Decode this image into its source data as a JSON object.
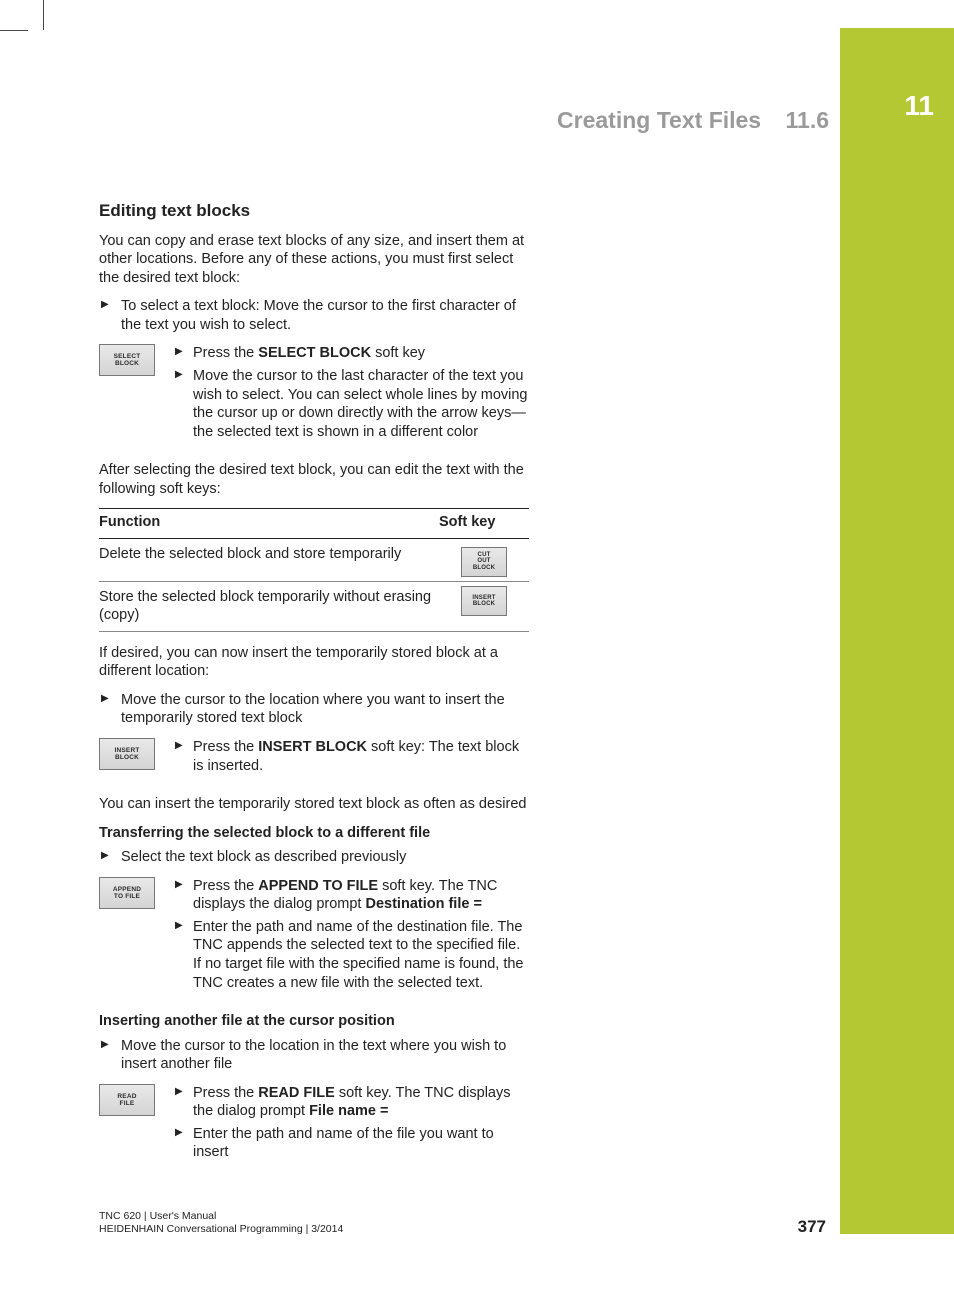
{
  "chapter": "11",
  "header": {
    "title": "Creating Text Files",
    "section": "11.6"
  },
  "h2": "Editing text blocks",
  "intro": "You can copy and erase text blocks of any size, and insert them at other locations. Before any of these actions, you must first select the desired text block:",
  "select_step": "To select a text block: Move the cursor to the first character of the text you wish to select.",
  "key_select": "SELECT\nBLOCK",
  "select_sub": {
    "a_pre": "Press the ",
    "a_bold": "SELECT BLOCK",
    "a_post": " soft key",
    "b": "Move the cursor to the last character of the text you wish to select. You can select whole lines by moving the cursor up or down directly with the arrow keys—the selected text is shown in a different color"
  },
  "after_select": "After selecting the desired text block, you can edit the text with the following soft keys:",
  "table": {
    "head_func": "Function",
    "head_key": "Soft key",
    "rows": [
      {
        "func": "Delete the selected block and store temporarily",
        "key": "CUT\nOUT\nBLOCK"
      },
      {
        "func": "Store the selected block temporarily without erasing (copy)",
        "key": "INSERT\nBLOCK"
      }
    ]
  },
  "insert_intro": "If desired, you can now insert the temporarily stored block at a different location:",
  "insert_step": "Move the cursor to the location where you want to insert the temporarily stored text block",
  "key_insert": "INSERT\nBLOCK",
  "insert_sub_pre": "Press the ",
  "insert_sub_bold": "INSERT BLOCK",
  "insert_sub_post": " soft key: The text block is inserted.",
  "insert_often": "You can insert the temporarily stored text block as often as desired",
  "transfer_head": "Transferring the selected block to a different file",
  "transfer_step": "Select the text block as described previously",
  "key_append": "APPEND\nTO FILE",
  "transfer_sub": {
    "a_pre": "Press the ",
    "a_bold": "APPEND TO FILE",
    "a_mid": " soft key. The TNC displays the dialog prompt ",
    "a_bold2": "Destination file =",
    "b": "Enter the path and name of the destination file. The TNC appends the selected text to the specified file. If no target file with the specified name is found, the TNC creates a new file with the selected text."
  },
  "insertfile_head": "Inserting another file at the cursor position",
  "insertfile_step": "Move the cursor to the location in the text where you wish to insert another file",
  "key_read": "READ\nFILE",
  "insertfile_sub": {
    "a_pre": "Press the ",
    "a_bold": "READ FILE",
    "a_mid": " soft key. The TNC displays the dialog prompt ",
    "a_bold2": "File name =",
    "b": "Enter the path and name of the file you want to insert"
  },
  "footer": {
    "line1": "TNC 620 | User's Manual",
    "line2": "HEIDENHAIN Conversational Programming | 3/2014",
    "page": "377"
  }
}
